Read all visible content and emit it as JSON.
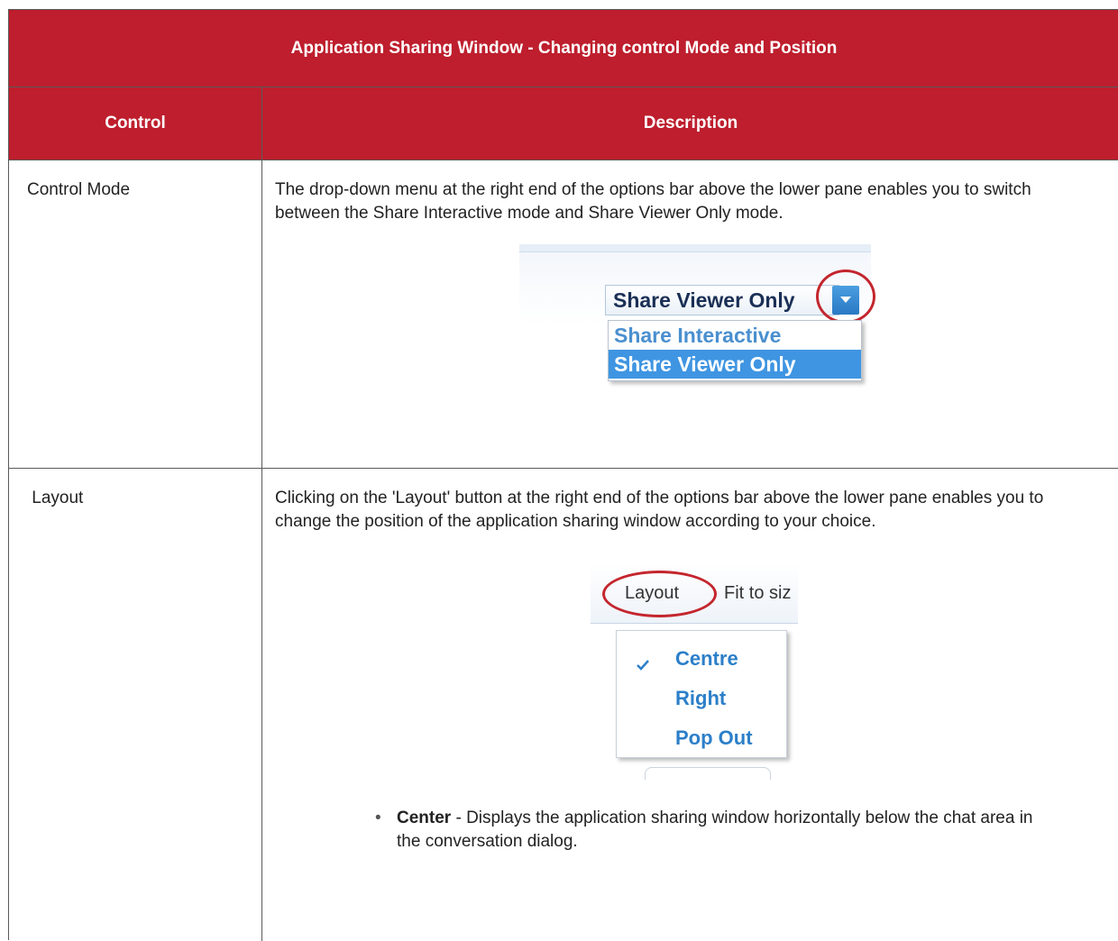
{
  "colors": {
    "header_bg": "#be1e2d",
    "header_text": "#ffffff",
    "accent_blue": "#3f95e2"
  },
  "table": {
    "title": "Application Sharing Window - Changing control Mode and Position",
    "headers": {
      "control": "Control",
      "description": "Description"
    },
    "rows": [
      {
        "control": "Control Mode",
        "description": "The drop-down menu at the right end of the options bar above the lower pane enables you to switch between the Share Interactive mode and Share Viewer Only mode.",
        "screenshot": {
          "selected_value": "Share Viewer Only",
          "options": [
            "Share Interactive",
            "Share Viewer Only"
          ],
          "icon": "chevron-down-icon"
        }
      },
      {
        "control": " Layout",
        "description": "Clicking on the 'Layout' button at the right end of the options bar above the lower pane enables you to change the position of the application sharing window according to your choice.",
        "screenshot": {
          "toolbar": {
            "layout": "Layout",
            "fit": "Fit to siz"
          },
          "menu": [
            "Centre",
            "Right",
            "Pop Out"
          ],
          "checked": "Centre",
          "icon": "checkmark-icon"
        },
        "bullet": {
          "term": "Center",
          "text": " - Displays the application sharing window horizontally below the chat area in the conversation dialog."
        }
      }
    ]
  }
}
